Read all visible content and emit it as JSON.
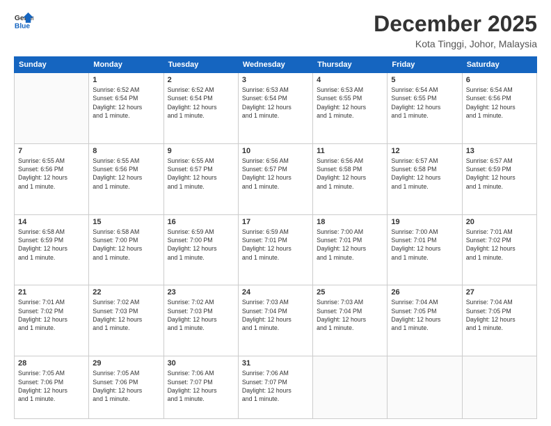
{
  "header": {
    "logo_line1": "General",
    "logo_line2": "Blue",
    "month_title": "December 2025",
    "location": "Kota Tinggi, Johor, Malaysia"
  },
  "days_of_week": [
    "Sunday",
    "Monday",
    "Tuesday",
    "Wednesday",
    "Thursday",
    "Friday",
    "Saturday"
  ],
  "weeks": [
    [
      {
        "day": "",
        "text": ""
      },
      {
        "day": "1",
        "text": "Sunrise: 6:52 AM\nSunset: 6:54 PM\nDaylight: 12 hours\nand 1 minute."
      },
      {
        "day": "2",
        "text": "Sunrise: 6:52 AM\nSunset: 6:54 PM\nDaylight: 12 hours\nand 1 minute."
      },
      {
        "day": "3",
        "text": "Sunrise: 6:53 AM\nSunset: 6:54 PM\nDaylight: 12 hours\nand 1 minute."
      },
      {
        "day": "4",
        "text": "Sunrise: 6:53 AM\nSunset: 6:55 PM\nDaylight: 12 hours\nand 1 minute."
      },
      {
        "day": "5",
        "text": "Sunrise: 6:54 AM\nSunset: 6:55 PM\nDaylight: 12 hours\nand 1 minute."
      },
      {
        "day": "6",
        "text": "Sunrise: 6:54 AM\nSunset: 6:56 PM\nDaylight: 12 hours\nand 1 minute."
      }
    ],
    [
      {
        "day": "7",
        "text": "Sunrise: 6:55 AM\nSunset: 6:56 PM\nDaylight: 12 hours\nand 1 minute."
      },
      {
        "day": "8",
        "text": "Sunrise: 6:55 AM\nSunset: 6:56 PM\nDaylight: 12 hours\nand 1 minute."
      },
      {
        "day": "9",
        "text": "Sunrise: 6:55 AM\nSunset: 6:57 PM\nDaylight: 12 hours\nand 1 minute."
      },
      {
        "day": "10",
        "text": "Sunrise: 6:56 AM\nSunset: 6:57 PM\nDaylight: 12 hours\nand 1 minute."
      },
      {
        "day": "11",
        "text": "Sunrise: 6:56 AM\nSunset: 6:58 PM\nDaylight: 12 hours\nand 1 minute."
      },
      {
        "day": "12",
        "text": "Sunrise: 6:57 AM\nSunset: 6:58 PM\nDaylight: 12 hours\nand 1 minute."
      },
      {
        "day": "13",
        "text": "Sunrise: 6:57 AM\nSunset: 6:59 PM\nDaylight: 12 hours\nand 1 minute."
      }
    ],
    [
      {
        "day": "14",
        "text": "Sunrise: 6:58 AM\nSunset: 6:59 PM\nDaylight: 12 hours\nand 1 minute."
      },
      {
        "day": "15",
        "text": "Sunrise: 6:58 AM\nSunset: 7:00 PM\nDaylight: 12 hours\nand 1 minute."
      },
      {
        "day": "16",
        "text": "Sunrise: 6:59 AM\nSunset: 7:00 PM\nDaylight: 12 hours\nand 1 minute."
      },
      {
        "day": "17",
        "text": "Sunrise: 6:59 AM\nSunset: 7:01 PM\nDaylight: 12 hours\nand 1 minute."
      },
      {
        "day": "18",
        "text": "Sunrise: 7:00 AM\nSunset: 7:01 PM\nDaylight: 12 hours\nand 1 minute."
      },
      {
        "day": "19",
        "text": "Sunrise: 7:00 AM\nSunset: 7:01 PM\nDaylight: 12 hours\nand 1 minute."
      },
      {
        "day": "20",
        "text": "Sunrise: 7:01 AM\nSunset: 7:02 PM\nDaylight: 12 hours\nand 1 minute."
      }
    ],
    [
      {
        "day": "21",
        "text": "Sunrise: 7:01 AM\nSunset: 7:02 PM\nDaylight: 12 hours\nand 1 minute."
      },
      {
        "day": "22",
        "text": "Sunrise: 7:02 AM\nSunset: 7:03 PM\nDaylight: 12 hours\nand 1 minute."
      },
      {
        "day": "23",
        "text": "Sunrise: 7:02 AM\nSunset: 7:03 PM\nDaylight: 12 hours\nand 1 minute."
      },
      {
        "day": "24",
        "text": "Sunrise: 7:03 AM\nSunset: 7:04 PM\nDaylight: 12 hours\nand 1 minute."
      },
      {
        "day": "25",
        "text": "Sunrise: 7:03 AM\nSunset: 7:04 PM\nDaylight: 12 hours\nand 1 minute."
      },
      {
        "day": "26",
        "text": "Sunrise: 7:04 AM\nSunset: 7:05 PM\nDaylight: 12 hours\nand 1 minute."
      },
      {
        "day": "27",
        "text": "Sunrise: 7:04 AM\nSunset: 7:05 PM\nDaylight: 12 hours\nand 1 minute."
      }
    ],
    [
      {
        "day": "28",
        "text": "Sunrise: 7:05 AM\nSunset: 7:06 PM\nDaylight: 12 hours\nand 1 minute."
      },
      {
        "day": "29",
        "text": "Sunrise: 7:05 AM\nSunset: 7:06 PM\nDaylight: 12 hours\nand 1 minute."
      },
      {
        "day": "30",
        "text": "Sunrise: 7:06 AM\nSunset: 7:07 PM\nDaylight: 12 hours\nand 1 minute."
      },
      {
        "day": "31",
        "text": "Sunrise: 7:06 AM\nSunset: 7:07 PM\nDaylight: 12 hours\nand 1 minute."
      },
      {
        "day": "",
        "text": ""
      },
      {
        "day": "",
        "text": ""
      },
      {
        "day": "",
        "text": ""
      }
    ]
  ]
}
